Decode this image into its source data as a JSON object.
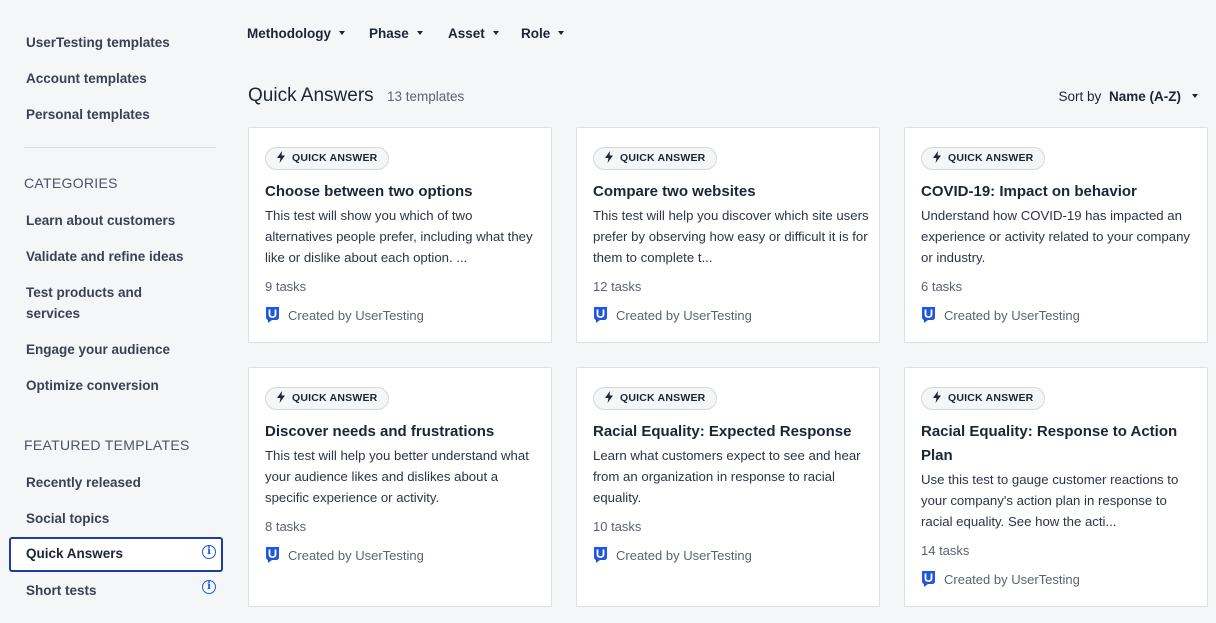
{
  "sidebar": {
    "templates": [
      {
        "label": "UserTesting templates"
      },
      {
        "label": "Account templates"
      },
      {
        "label": "Personal templates"
      }
    ],
    "categories_heading": "CATEGORIES",
    "categories": [
      {
        "label": "Learn about customers"
      },
      {
        "label": "Validate and refine ideas"
      },
      {
        "label": "Test products and services"
      },
      {
        "label": "Engage your audience"
      },
      {
        "label": "Optimize conversion"
      }
    ],
    "featured_heading": "FEATURED TEMPLATES",
    "featured": [
      {
        "label": "Recently released"
      },
      {
        "label": "Social topics"
      },
      {
        "label": "Quick Answers",
        "active": true
      },
      {
        "label": "Short tests"
      }
    ]
  },
  "filters": [
    {
      "label": "Methodology"
    },
    {
      "label": "Phase"
    },
    {
      "label": "Asset"
    },
    {
      "label": "Role"
    }
  ],
  "main": {
    "title": "Quick Answers",
    "count": "13 templates",
    "sort_label": "Sort by",
    "sort_value": "Name (A-Z)"
  },
  "cards": [
    {
      "badge": "QUICK ANSWER",
      "title": "Choose between two options",
      "description": "This test will show you which of two alternatives people prefer, including what they like or dislike about each option. ...",
      "tasks": "9 tasks",
      "creator": "Created by UserTesting"
    },
    {
      "badge": "QUICK ANSWER",
      "title": "Compare two websites",
      "description": "This test will help you discover which site users prefer by observing how easy or difficult it is for them to complete t...",
      "tasks": "12 tasks",
      "creator": "Created by UserTesting"
    },
    {
      "badge": "QUICK ANSWER",
      "title": "COVID-19: Impact on behavior",
      "description": "Understand how COVID-19 has impacted an experience or activity related to your company or industry.",
      "tasks": "6 tasks",
      "creator": "Created by UserTesting"
    },
    {
      "badge": "QUICK ANSWER",
      "title": "Discover needs and frustrations",
      "description": "This test will help you better understand what your audience likes and dislikes about a specific experience or activity.",
      "tasks": "8 tasks",
      "creator": "Created by UserTesting"
    },
    {
      "badge": "QUICK ANSWER",
      "title": "Racial Equality: Expected Response",
      "description": "Learn what customers expect to see and hear from an organization in response to racial equality.",
      "tasks": "10 tasks",
      "creator": "Created by UserTesting"
    },
    {
      "badge": "QUICK ANSWER",
      "title": "Racial Equality: Response to Action Plan",
      "description": "Use this test to gauge customer reactions to your company's action plan in response to racial equality. See how the acti...",
      "tasks": "14 tasks",
      "creator": "Created by UserTesting"
    }
  ],
  "colors": {
    "accent": "#1f56e0",
    "active_border": "#1b3f97"
  }
}
